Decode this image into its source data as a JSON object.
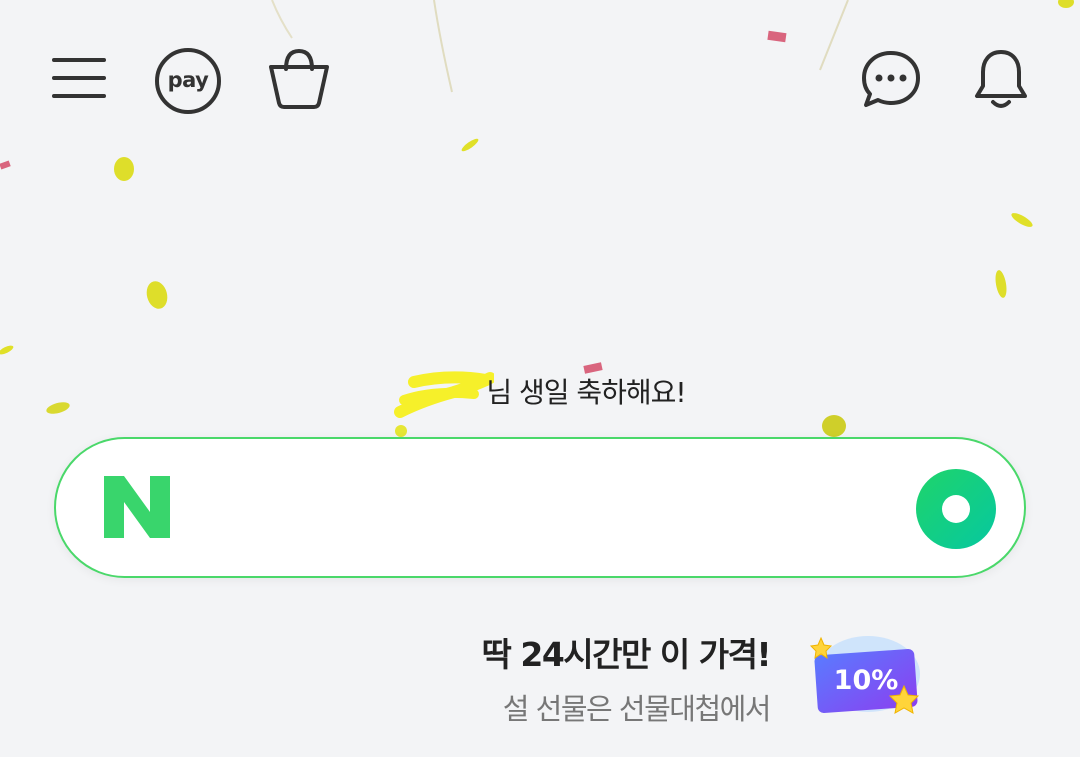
{
  "header": {
    "menu_icon": "hamburger-menu-icon",
    "pay_label": "pay",
    "shopping_icon": "shopping-basket-icon",
    "talk_icon": "chat-bubble-icon",
    "notification_icon": "bell-icon"
  },
  "greeting": {
    "suffix": "님 생일 축하해요!"
  },
  "search": {
    "logo_letter": "N",
    "placeholder": "",
    "value": "",
    "action_icon": "green-ring-icon",
    "brand_color": "#03c75a"
  },
  "promo": {
    "title": "딱 24시간만 이 가격!",
    "subtitle": "설 선물은 선물대첩에서",
    "badge_text": "10%"
  },
  "colors": {
    "background": "#f3f4f6",
    "search_border": "#4ad86a",
    "confetti_yellow": "#dede2a",
    "confetti_pink": "#d9657e"
  }
}
